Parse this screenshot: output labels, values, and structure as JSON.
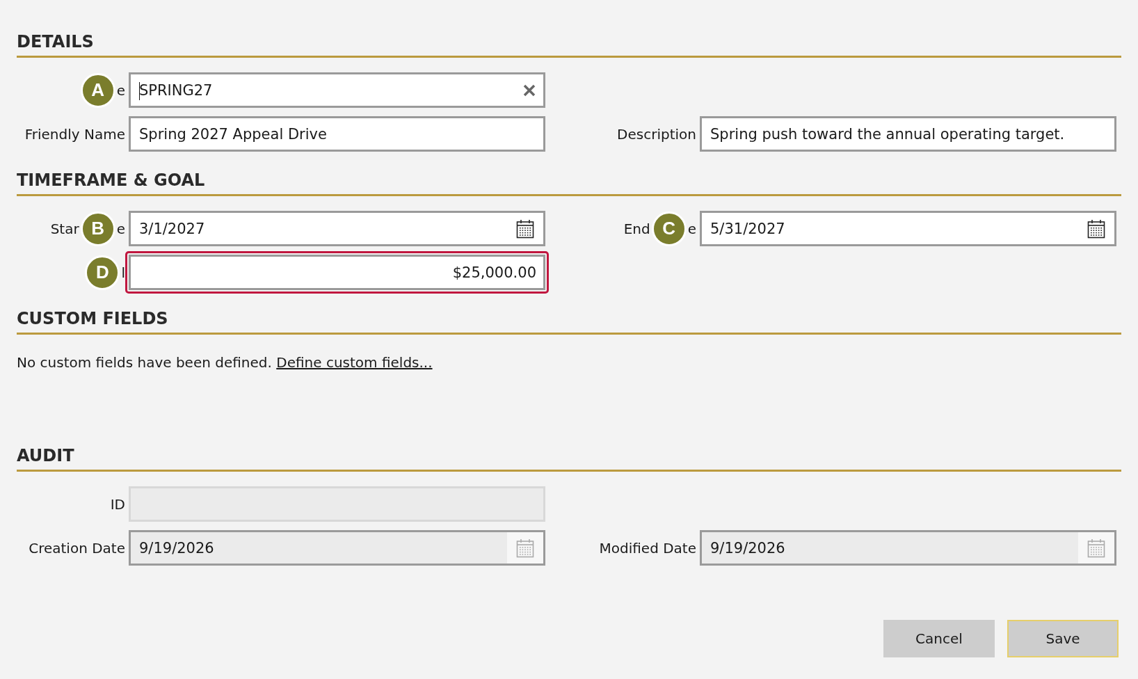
{
  "sections": [
    {
      "title": "DETAILS",
      "kind": "fields",
      "rows": [
        [
          {
            "kind": "text",
            "badge": "A",
            "label_after": "e",
            "value": "SPRING27",
            "focused": true,
            "clear_button": true,
            "disabled": false,
            "invalid": false
          }
        ],
        [
          {
            "kind": "text",
            "label": "Friendly Name",
            "value": "Spring 2027 Appeal Drive",
            "focused": false,
            "clear_button": false,
            "disabled": false,
            "invalid": false
          },
          {
            "kind": "text",
            "label": "Description",
            "value": "Spring push toward the annual operating target.",
            "focused": false,
            "clear_button": false,
            "disabled": false,
            "invalid": false
          }
        ]
      ]
    },
    {
      "title": "TIMEFRAME & GOAL",
      "kind": "fields",
      "rows": [
        [
          {
            "kind": "date",
            "badge": "B",
            "label_before": "Star",
            "label_after": "e",
            "value": "3/1/2027",
            "focused": false,
            "disabled": false,
            "invalid": false
          },
          {
            "kind": "date",
            "badge": "C",
            "label_before": "End",
            "label_after": "e",
            "value": "5/31/2027",
            "focused": false,
            "disabled": false,
            "invalid": false
          }
        ],
        [
          {
            "kind": "number",
            "badge": "D",
            "label_after": "l",
            "value": "$25,000.00",
            "focused": false,
            "clear_button": false,
            "disabled": false,
            "invalid": true
          }
        ]
      ]
    },
    {
      "title": "CUSTOM FIELDS",
      "kind": "message",
      "text": "No custom fields have been defined.",
      "link": "Define custom fields..."
    },
    {
      "title": "AUDIT",
      "kind": "fields",
      "rows": [
        [
          {
            "kind": "text",
            "label": "ID",
            "focused": false,
            "clear_button": false,
            "disabled": true,
            "invalid": false
          }
        ],
        [
          {
            "kind": "date",
            "label": "Creation Date",
            "value": "9/19/2026",
            "focused": false,
            "disabled": true,
            "invalid": false
          },
          {
            "kind": "date",
            "label": "Modified Date",
            "value": "9/19/2026",
            "focused": false,
            "disabled": true,
            "invalid": false
          }
        ]
      ]
    }
  ],
  "buttons": [
    {
      "label": "Cancel",
      "default": false
    },
    {
      "label": "Save",
      "default": true
    }
  ]
}
